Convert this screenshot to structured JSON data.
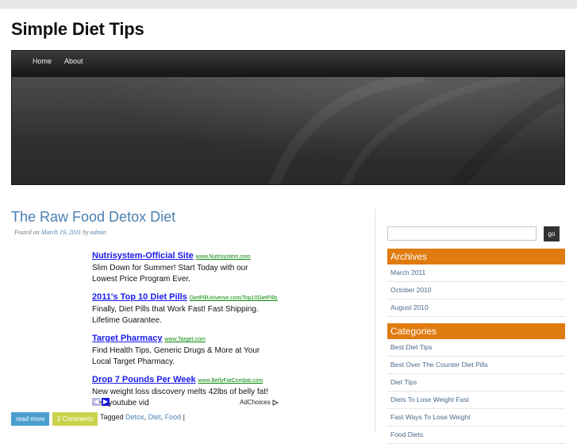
{
  "site": {
    "title": "Simple Diet Tips"
  },
  "nav": {
    "items": [
      "Home",
      "About"
    ]
  },
  "post": {
    "title": "The Raw Food Detox Diet",
    "posted_on": "Posted on",
    "date": "March 19, 2011",
    "by": "by",
    "author": "admin",
    "read_more": "read more",
    "comments": "2 Comments",
    "tagged": "Tagged",
    "tags": [
      "Detox",
      "Diet",
      "Food"
    ]
  },
  "ads": [
    {
      "headline": "Nutrisystem-Official Site",
      "url": "www.Nutrisystem.com",
      "desc1": "Slim Down for Summer! Start Today with our",
      "desc2": "Lowest Price Program Ever."
    },
    {
      "headline": "2011's Top 10 Diet Pills",
      "url": "DietPillUniverse.com/Top10DietPills",
      "desc1": "Finally, Diet Pills that Work Fast! Fast Shipping.",
      "desc2": "Lifetime Guarantee."
    },
    {
      "headline": "Target Pharmacy",
      "url": "www.Target.com",
      "desc1": "Find Health Tips, Generic Drugs & More at Your",
      "desc2": "Local Target Pharmacy."
    },
    {
      "headline": "Drop 7 Pounds Per Week",
      "url": "www.BellyFatCombat.com",
      "desc1": "New weight loss discovery melts 42lbs of belly fat!",
      "desc2": "See youtube vid"
    }
  ],
  "adchoices": "AdChoices",
  "search": {
    "button": "go",
    "placeholder": ""
  },
  "archives": {
    "title": "Archives",
    "items": [
      "March 2011",
      "October 2010",
      "August 2010"
    ]
  },
  "categories": {
    "title": "Categories",
    "items": [
      "Best Diet Tips",
      "Best Over The Counter Diet Pills",
      "Diet Tips",
      "Diets To Lose Weight Fast",
      "Fast Ways To Lose Weight",
      "Food Diets"
    ]
  },
  "colors": {
    "accent": "#e07b10",
    "link": "#4a7fb0",
    "ad_link": "#1a1aee",
    "ad_url": "#0a8a0a"
  }
}
